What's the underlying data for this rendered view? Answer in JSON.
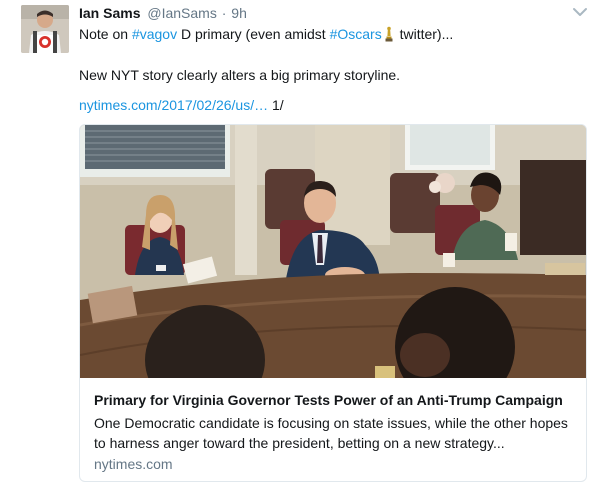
{
  "tweet": {
    "author_name": "Ian Sams",
    "author_handle": "@IanSams",
    "separator": "·",
    "time": "9h",
    "text": {
      "part1": "Note on ",
      "hashtag1": "#vagov",
      "part2": " D primary (even amidst ",
      "hashtag2": "#Oscars",
      "part3": " twitter)...",
      "line2": "New NYT story clearly alters a big primary storyline.",
      "link": "nytimes.com/2017/02/26/us/…",
      "thread_marker": " 1/"
    },
    "icons": {
      "menu": "chevron-down-icon",
      "emoji": "oscar-statuette-icon"
    }
  },
  "card": {
    "title": "Primary for Virginia Governor Tests Power of an Anti-Trump Campaign",
    "description": "One Democratic candidate is focusing on state issues, while the other hopes to harness anger toward the president, betting on a new strategy...",
    "domain": "nytimes.com"
  },
  "colors": {
    "link": "#1b95e0",
    "secondary_text": "#657786",
    "border": "#e1e8ed"
  }
}
